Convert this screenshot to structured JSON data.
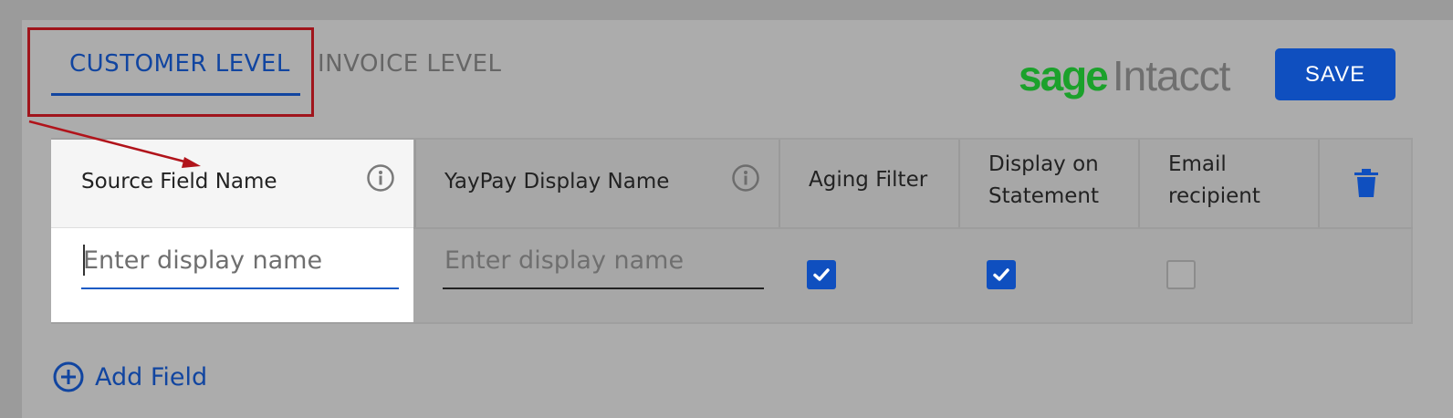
{
  "tabs": {
    "customer_level": "CUSTOMER LEVEL",
    "invoice_level": "INVOICE LEVEL"
  },
  "logo": {
    "brand": "sage",
    "product": "Intacct"
  },
  "toolbar": {
    "save_label": "SAVE"
  },
  "table": {
    "columns": {
      "source_field_name": "Source Field Name",
      "yaypay_display_name": "YayPay Display Name",
      "aging_filter": "Aging Filter",
      "display_on_statement_line1": "Display on",
      "display_on_statement_line2": "Statement",
      "email_recipient_line1": "Email",
      "email_recipient_line2": "recipient"
    },
    "row": {
      "source_placeholder": "Enter display name",
      "display_placeholder": "Enter display name",
      "aging_filter_checked": true,
      "display_on_statement_checked": true,
      "email_recipient_checked": false
    }
  },
  "actions": {
    "add_field_label": "Add Field"
  },
  "colors": {
    "accent_blue": "#0f4fbf",
    "tab_active": "#1145a0",
    "annotation_red": "#a0151c",
    "sage_green": "#1ba12b"
  },
  "icons": {
    "info": "info-icon",
    "trash": "trash-icon",
    "add": "plus-circle-icon",
    "check": "check-icon"
  }
}
